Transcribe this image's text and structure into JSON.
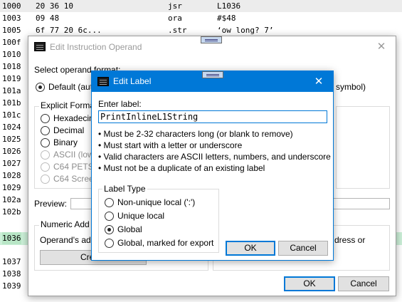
{
  "listing": {
    "rows": [
      {
        "addr": "1000",
        "bytes": "20 36 10",
        "op": "jsr",
        "arg": "L1036"
      },
      {
        "addr": "1003",
        "bytes": "09 48",
        "op": "ora",
        "arg": "#$48"
      },
      {
        "addr": "1005",
        "bytes": "6f 77 20 6c...",
        "op": ".str",
        "arg": "‘ow long? 7’"
      },
      {
        "addr": "100f",
        "bytes": "",
        "op": "",
        "arg": ""
      },
      {
        "addr": "1010",
        "bytes": "",
        "op": "",
        "arg": ""
      },
      {
        "addr": "1018",
        "bytes": "",
        "op": "",
        "arg": ""
      },
      {
        "addr": "1019",
        "bytes": "",
        "op": "",
        "arg": ""
      },
      {
        "addr": "101a",
        "bytes": "",
        "op": "",
        "arg": ""
      },
      {
        "addr": "101b",
        "bytes": "",
        "op": "",
        "arg": ""
      },
      {
        "addr": "101c",
        "bytes": "",
        "op": "",
        "arg": ""
      },
      {
        "addr": "1024",
        "bytes": "",
        "op": "",
        "arg": ""
      },
      {
        "addr": "1025",
        "bytes": "",
        "op": "",
        "arg": ""
      },
      {
        "addr": "1026",
        "bytes": "",
        "op": "",
        "arg": ""
      },
      {
        "addr": "1027",
        "bytes": "",
        "op": "",
        "arg": ""
      },
      {
        "addr": "1028",
        "bytes": "",
        "op": "",
        "arg": ""
      },
      {
        "addr": "1029",
        "bytes": "",
        "op": "",
        "arg": ""
      },
      {
        "addr": "102a",
        "bytes": "",
        "op": "",
        "arg": ""
      },
      {
        "addr": "102b",
        "bytes": "",
        "op": "",
        "arg": ""
      },
      {
        "addr": "1036",
        "bytes": "",
        "op": "",
        "arg": ""
      },
      {
        "addr": "1037",
        "bytes": "",
        "op": "",
        "arg": ""
      },
      {
        "addr": "1038",
        "bytes": "",
        "op": "",
        "arg": ""
      },
      {
        "addr": "1039",
        "bytes": "",
        "op": "",
        "arg": ""
      }
    ]
  },
  "operand_dialog": {
    "title": "Edit Instruction Operand",
    "select_format_label": "Select operand format:",
    "default_option_label": "Default (aut",
    "default_option_tail": "symbol)",
    "explicit_format_title": "Explicit Forma",
    "formats": [
      {
        "label": "Hexadecim",
        "enabled": true
      },
      {
        "label": "Decimal",
        "enabled": true
      },
      {
        "label": "Binary",
        "enabled": true
      },
      {
        "label": "ASCII (low",
        "enabled": false
      },
      {
        "label": "C64 PETSC",
        "enabled": false
      },
      {
        "label": "C64 Scree",
        "enabled": false
      }
    ],
    "preview_label": "Preview:",
    "numeric_address_title": "Numeric Add",
    "operand_address_text": "Operand's ad",
    "address_or_text": "dress or",
    "create_button": "Create",
    "ok_button": "OK",
    "cancel_button": "Cancel"
  },
  "label_dialog": {
    "title": "Edit Label",
    "enter_label": "Enter label:",
    "label_value": "PrintInlineL1String",
    "rules": [
      "• Must be 2-32 characters long (or blank to remove)",
      "• Must start with a letter or underscore",
      "• Valid characters are ASCII letters, numbers, and underscore",
      "• Must not be a duplicate of an existing label"
    ],
    "label_type_title": "Label Type",
    "label_types": [
      {
        "label": "Non-unique local (':')",
        "selected": false
      },
      {
        "label": "Unique local",
        "selected": false
      },
      {
        "label": "Global",
        "selected": true
      },
      {
        "label": "Global, marked for export",
        "selected": false
      }
    ],
    "ok_button": "OK",
    "cancel_button": "Cancel"
  }
}
